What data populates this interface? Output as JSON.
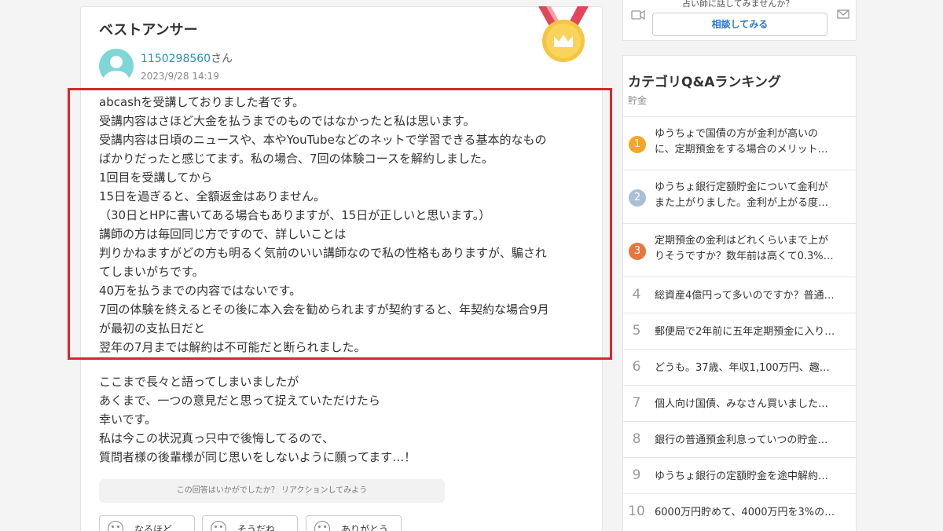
{
  "answer": {
    "heading": "ベストアンサー",
    "user_id": "1150298560",
    "user_suffix": "さん",
    "date": "2023/9/28 14:19",
    "highlighted_lines": [
      "abcashを受講しておりました者です。",
      "受講内容はさほど大金を払うまでのものではなかったと私は思います。",
      "受講内容は日頃のニュースや、本やYouTubeなどのネットで学習できる基本的なもの",
      "ばかりだったと感じてます。私の場合、7回の体験コースを解約しました。",
      "1回目を受講してから",
      "15日を過ぎると、全額返金はありません。",
      "（30日とHPに書いてある場合もありますが、15日が正しいと思います。）",
      "講師の方は毎回同じ方ですので、詳しいことは",
      "判りかねますがどの方も明るく気前のいい講師なので私の性格もありますが、騙され",
      "てしまいがちです。",
      "40万を払うまでの内容ではないです。",
      "7回の体験を終えるとその後に本入会を勧められますが契約すると、年契約な場合9月",
      "が最初の支払日だと",
      "翌年の7月までは解約は不可能だと断られました。"
    ],
    "closing_lines": [
      "ここまで長々と語ってしまいましたが",
      "あくまで、一つの意見だと思って捉えていただけたら",
      "幸いです。",
      "私は今この状況真っ只中で後悔してるので、",
      "質問者様の後輩様が同じ思いをしないように願ってます…！"
    ],
    "reaction_prompt": "この回答はいかがでしたか？ リアクションしてみよう",
    "reactions": [
      "なるほど",
      "そうだね",
      "ありがとう"
    ]
  },
  "consult": {
    "prompt": "占い師に話してみませんか？",
    "button": "相談してみる"
  },
  "ranking": {
    "title": "カテゴリQ&Aランキング",
    "category": "貯金",
    "items": [
      {
        "rank": "1",
        "lines": [
          "ゆうちょで国債の方が金利が高いの",
          "に、定期預金をする場合のメリット…"
        ]
      },
      {
        "rank": "2",
        "lines": [
          "ゆうちょ銀行定額貯金について金利が",
          "また上がりました。金利が上がる度…"
        ]
      },
      {
        "rank": "3",
        "lines": [
          "定期預金の金利はどれくらいまで上が",
          "りそうですか？数年前は高くて0.3%…"
        ]
      },
      {
        "rank": "4",
        "lines": [
          "総資産4億円って多いのですか？普通…"
        ]
      },
      {
        "rank": "5",
        "lines": [
          "郵便局で2年前に五年定期預金に入り…"
        ]
      },
      {
        "rank": "6",
        "lines": [
          "どうも。37歳、年収1,100万円、趣…"
        ]
      },
      {
        "rank": "7",
        "lines": [
          "個人向け国債、みなさん買いました…"
        ]
      },
      {
        "rank": "8",
        "lines": [
          "銀行の普通預金利息っていつの貯金…"
        ]
      },
      {
        "rank": "9",
        "lines": [
          "ゆうちょ銀行の定額貯金を途中解約…"
        ]
      },
      {
        "rank": "10",
        "lines": [
          "6000万円貯めて、4000万円を3%の…"
        ]
      }
    ],
    "badge_colors": {
      "1": "#f5a623",
      "2": "#a9bfd6",
      "3": "#e8763f"
    }
  }
}
